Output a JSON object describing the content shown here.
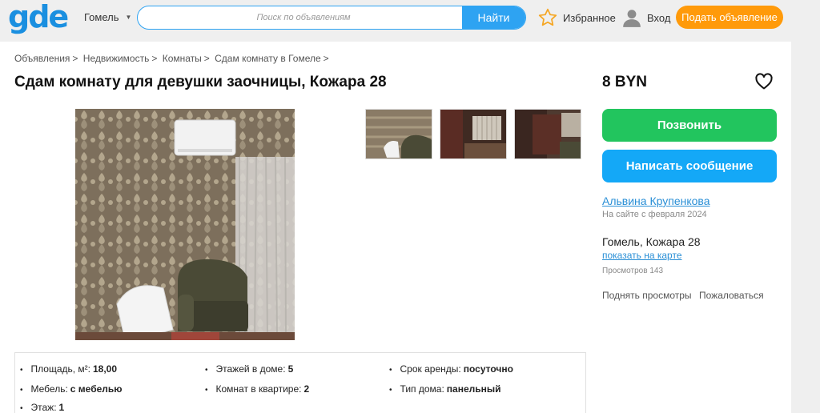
{
  "header": {
    "logo": "gde",
    "city": "Гомель",
    "search_placeholder": "Поиск по объявлениям",
    "search_button": "Найти",
    "favorites": "Избранное",
    "login": "Вход",
    "post_ad": "Подать объявление"
  },
  "breadcrumb": [
    "Объявления",
    "Недвижимость",
    "Комнаты",
    "Сдам комнату в Гомеле"
  ],
  "listing": {
    "title": "Сдам комнату для девушки заочницы, Кожара 28",
    "price": "8 BYN",
    "call_button": "Позвонить",
    "message_button": "Написать сообщение",
    "seller_name": "Альвина Крупенкова",
    "seller_since": "На сайте с февраля 2024",
    "address": "Гомель, Кожара 28",
    "show_on_map": "показать на карте",
    "views": "Просмотров 143",
    "raise_views": "Поднять просмотры",
    "complain": "Пожаловаться"
  },
  "params": {
    "area_label": "Площадь, м²:",
    "area_value": "18,00",
    "floors_label": "Этажей в доме:",
    "floors_value": "5",
    "term_label": "Срок аренды:",
    "term_value": "посуточно",
    "furniture_label": "Мебель:",
    "furniture_value": "с мебелью",
    "rooms_label": "Комнат в квартире:",
    "rooms_value": "2",
    "house_label": "Тип дома:",
    "house_value": "панельный",
    "floor_label": "Этаж:",
    "floor_value": "1"
  },
  "colors": {
    "brand_blue": "#1a8fe0",
    "search_blue": "#2ea3f2",
    "post_orange": "#ff9a0a",
    "call_green": "#22c55e",
    "message_blue": "#14a8f7"
  },
  "icons": [
    "star-icon",
    "user-icon",
    "heart-icon",
    "chevron-down-icon"
  ]
}
